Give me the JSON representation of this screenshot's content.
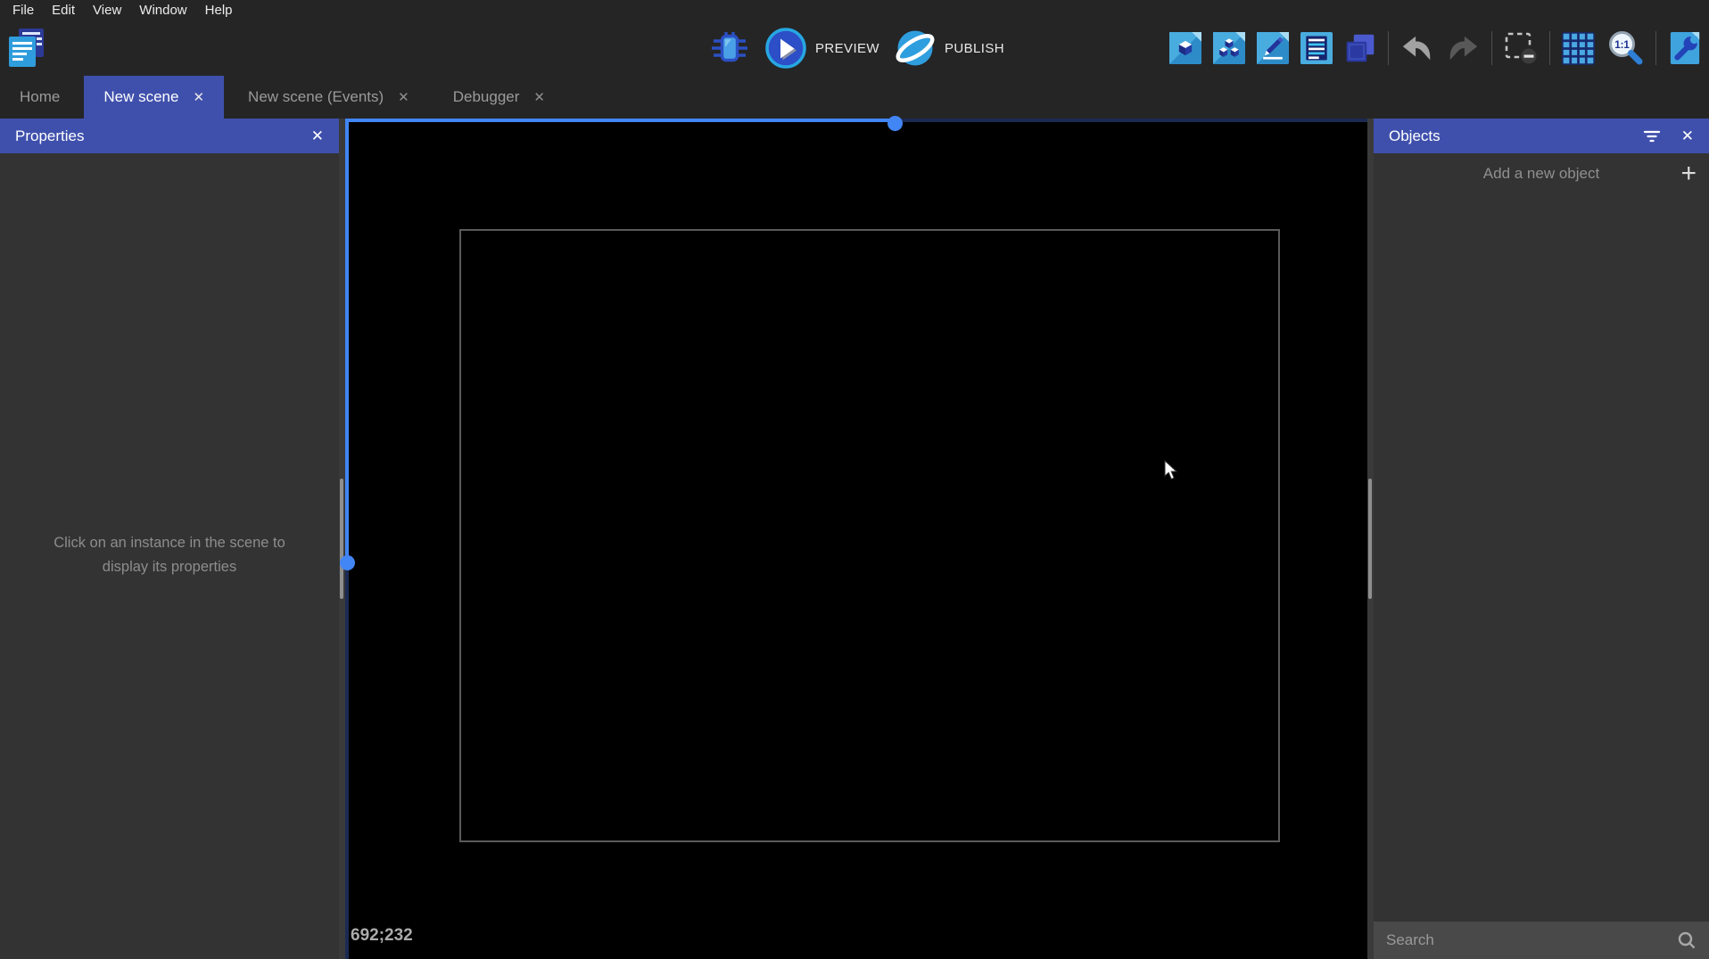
{
  "window": {
    "menu_items": [
      "File",
      "Edit",
      "View",
      "Window",
      "Help"
    ]
  },
  "toolbar": {
    "preview_label": "PREVIEW",
    "publish_label": "PUBLISH",
    "icon_names": [
      "project-manager-icon",
      "debug-icon",
      "preview-play-icon",
      "publish-globe-icon",
      "open-objects-editor-icon",
      "open-object-groups-icon",
      "open-properties-icon",
      "open-instances-list-icon",
      "open-layers-icon",
      "undo-icon",
      "redo-icon",
      "clear-selection-icon",
      "toggle-grid-icon",
      "zoom-1-1-icon",
      "project-settings-icon"
    ]
  },
  "tabs": [
    {
      "label": "Home"
    },
    {
      "label": "New scene",
      "close_label": "✕",
      "active": true
    },
    {
      "label": "New scene (Events)",
      "close_label": "✕"
    },
    {
      "label": "Debugger",
      "close_label": "✕"
    }
  ],
  "properties_panel": {
    "title": "Properties",
    "close_label": "✕",
    "empty_message": "Click on an instance in the scene to display its properties"
  },
  "scene_canvas": {
    "cursor_coordinates": "692;232"
  },
  "objects_panel": {
    "title": "Objects",
    "close_label": "✕",
    "add_button_label": "Add a new object",
    "add_button_plus": "+",
    "search_placeholder": "Search"
  },
  "colors": {
    "accent_blue": "#4285f4",
    "header_blue": "#3f50ac",
    "topbar_bg": "#252526",
    "panel_bg": "#333333",
    "canvas_bg": "#000000",
    "scrollbar_track_navy": "#1b2a52"
  }
}
